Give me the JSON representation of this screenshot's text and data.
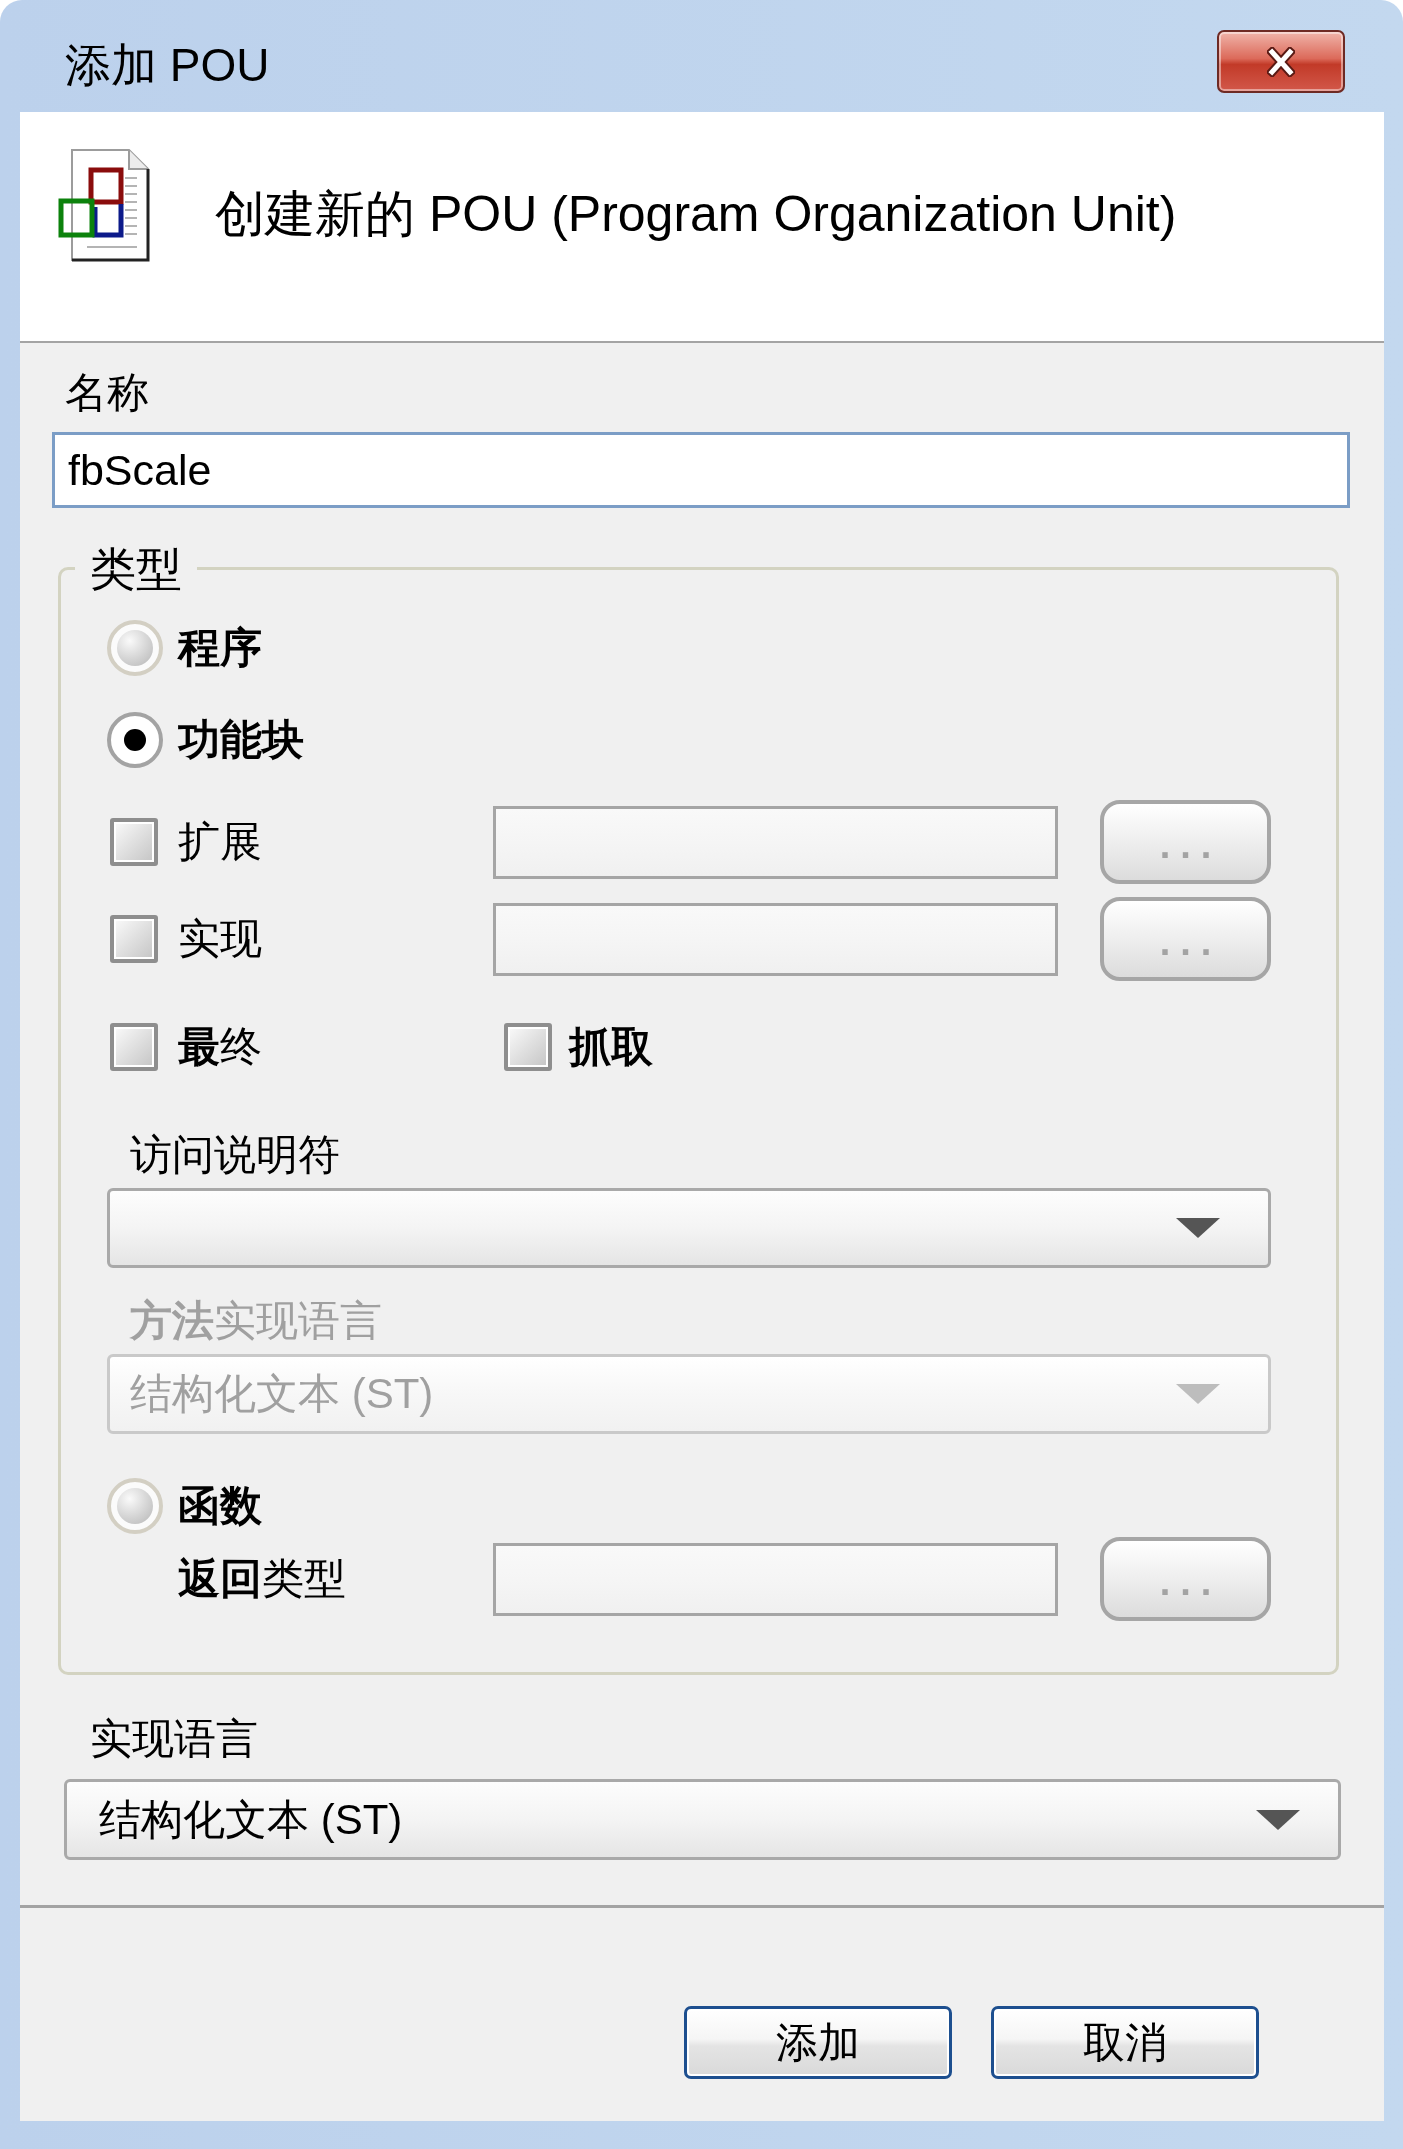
{
  "window": {
    "title": "添加 POU"
  },
  "header": {
    "text": "创建新的 POU (Program Organization Unit)"
  },
  "name": {
    "label": "名称",
    "value": "fbScale"
  },
  "type_group": {
    "legend": "类型",
    "items": [
      {
        "kind": "radio",
        "label": "程序",
        "selected": false
      },
      {
        "kind": "radio",
        "label": "功能块",
        "selected": true
      },
      {
        "kind": "check_field",
        "label": "扩展",
        "checked": false,
        "button": "..."
      },
      {
        "kind": "check_field",
        "label": "实现",
        "checked": false,
        "button": "..."
      },
      {
        "kind": "check_pair",
        "checks": [
          {
            "label": "**最**终",
            "checked": false,
            "bold": false
          },
          {
            "label": "抓取",
            "checked": false,
            "bold": true
          }
        ]
      },
      {
        "kind": "dropdown",
        "label": "访问说明符",
        "disabled": false
      },
      {
        "kind": "dropdown",
        "label": "**方法**实现语言",
        "value": "结构化文本 (ST)",
        "disabled": true
      },
      {
        "kind": "radio",
        "label": "函数",
        "selected": false
      },
      {
        "kind": "labeled_field",
        "label": "**返回**类型",
        "button": "..."
      }
    ]
  },
  "language": {
    "label": "实现语言",
    "value": "结构化文本 (ST)"
  },
  "buttons": [
    {
      "label": "添加"
    },
    {
      "label": "取消"
    }
  ]
}
